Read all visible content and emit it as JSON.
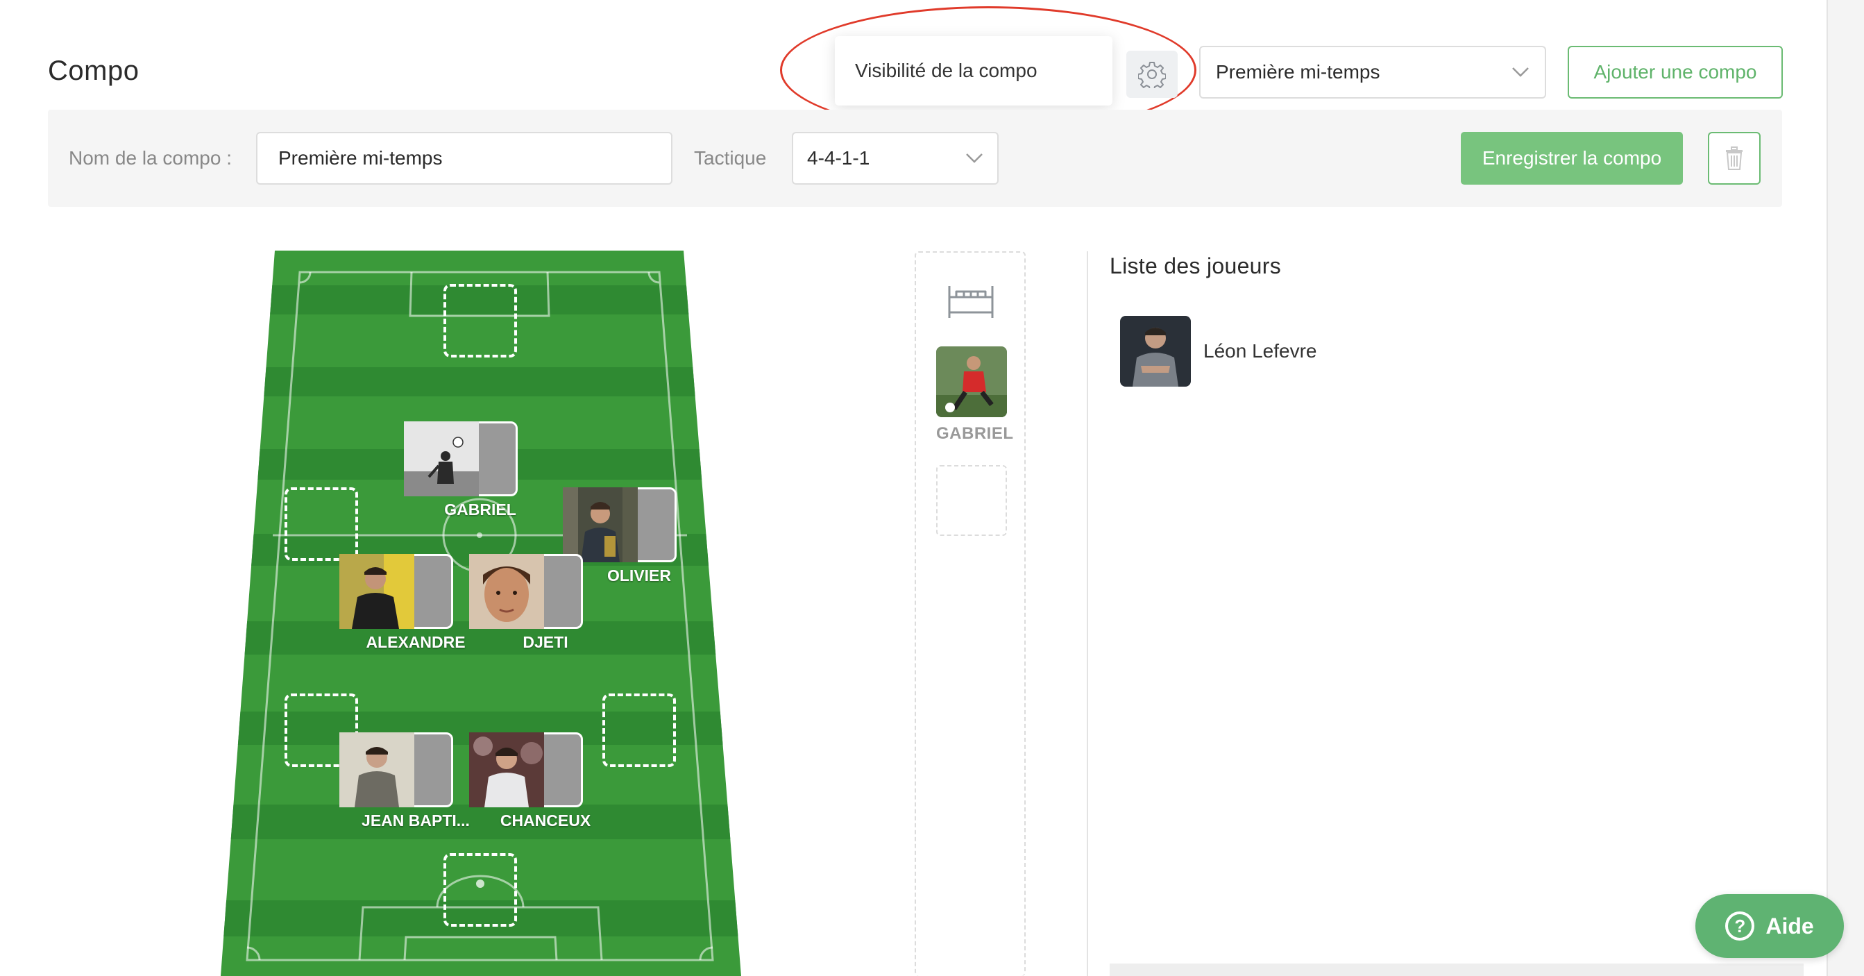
{
  "header": {
    "title": "Compo",
    "visibility_popup": "Visibilité de la compo",
    "half_select": "Première mi-temps",
    "add_button": "Ajouter une compo"
  },
  "toolbar": {
    "name_label": "Nom de la compo :",
    "name_value": "Première mi-temps",
    "tactic_label": "Tactique",
    "tactic_value": "4-4-1-1",
    "save_button": "Enregistrer la compo"
  },
  "pitch": {
    "players": [
      {
        "name": "GABRIEL",
        "photo": "ball-juggler"
      },
      {
        "name": "OLIVIER",
        "photo": "man-forest"
      },
      {
        "name": "ALEXANDRE",
        "photo": "man-yellow"
      },
      {
        "name": "DJETI",
        "photo": "boy-portrait"
      },
      {
        "name": "JEAN BAPTI...",
        "photo": "man-beige"
      },
      {
        "name": "CHANCEUX",
        "photo": "man-white-shirt"
      }
    ]
  },
  "bench": {
    "players": [
      {
        "name": "GABRIEL",
        "photo": "footballer-red"
      }
    ]
  },
  "player_list": {
    "title": "Liste des joueurs",
    "players": [
      {
        "name": "Léon Lefevre",
        "photo": "man-grey"
      }
    ]
  },
  "help_button": {
    "label": "Aide",
    "icon": "?"
  },
  "colors": {
    "accent": "#78c47e",
    "pitch_dark": "#2f8a32",
    "pitch_light": "#3e9c3d",
    "highlight": "#e03a2a"
  }
}
